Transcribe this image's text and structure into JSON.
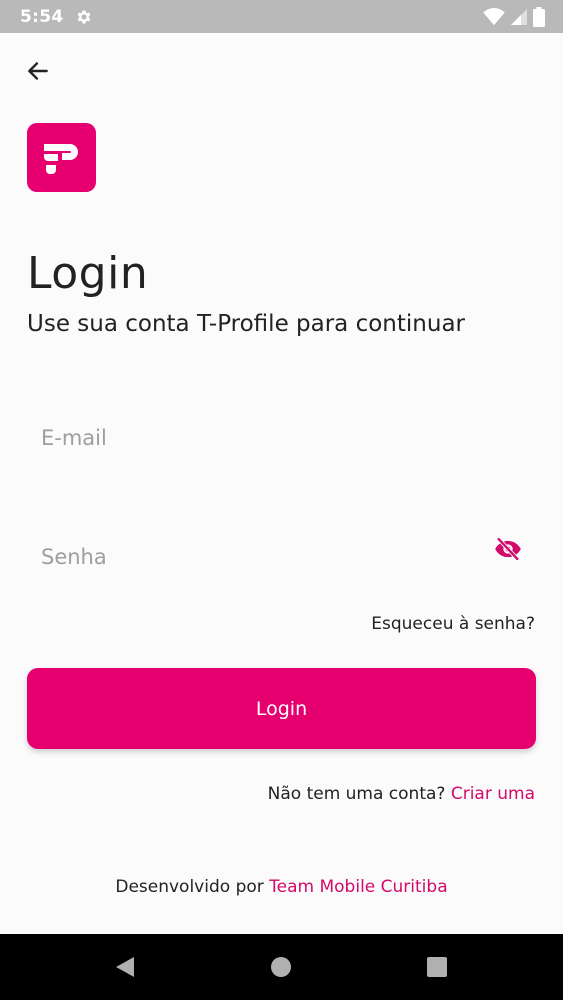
{
  "status_bar": {
    "time": "5:54"
  },
  "screen": {
    "title": "Login",
    "subtitle": "Use sua conta T-Profile para continuar"
  },
  "form": {
    "email_placeholder": "E-mail",
    "email_value": "",
    "password_placeholder": "Senha",
    "password_value": "",
    "forgot_label": "Esqueceu à senha?",
    "login_label": "Login"
  },
  "signup": {
    "prompt": "Não tem uma conta?",
    "link_label": "Criar uma"
  },
  "footer": {
    "prefix": "Desenvolvido por",
    "link_label": "Team Mobile Curitiba"
  },
  "colors": {
    "brand": "#e6006f",
    "link": "#d10a6b"
  },
  "icons": {
    "back": "arrow-left-icon",
    "password_toggle": "eye-off-icon",
    "logo": "t-profile-logo"
  }
}
